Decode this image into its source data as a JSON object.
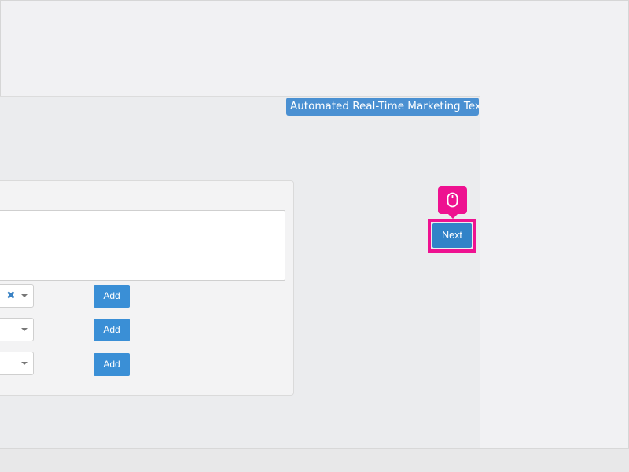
{
  "header": {
    "title": "Automated Real-Time Marketing Text"
  },
  "form": {
    "textarea_value": "",
    "rows": [
      {
        "select_value": "",
        "has_clear": true,
        "add_label": "Add"
      },
      {
        "select_value": "",
        "has_clear": false,
        "add_label": "Add"
      },
      {
        "select_value": "",
        "has_clear": false,
        "add_label": "Add"
      }
    ],
    "clear_glyph": "✖"
  },
  "navigation": {
    "next_label": "Next"
  },
  "tutorial": {
    "hint_icon": "mouse-icon",
    "highlight_color": "#ee1190"
  },
  "colors": {
    "accent": "#3a8fd6",
    "title_badge": "#4a90d2",
    "highlight": "#ee1190"
  }
}
